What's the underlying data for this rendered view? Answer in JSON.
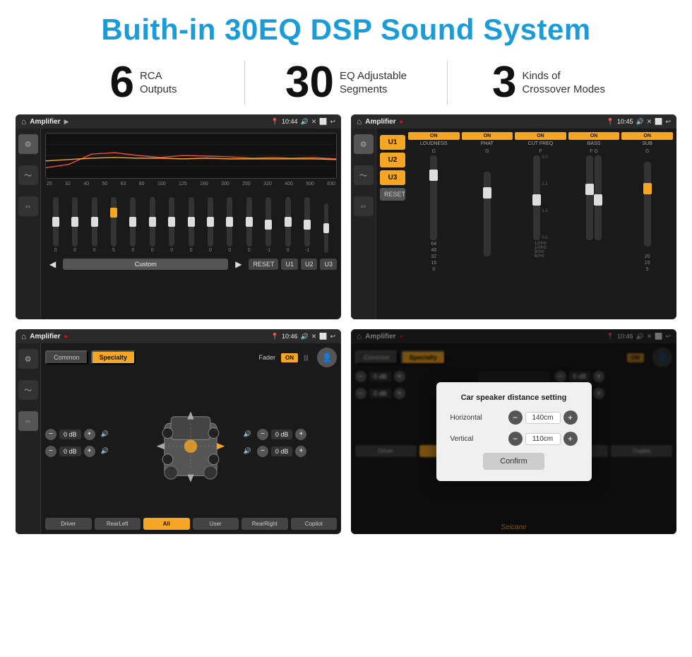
{
  "header": {
    "title": "Buith-in 30EQ DSP Sound System"
  },
  "stats": [
    {
      "number": "6",
      "label": "RCA\nOutputs"
    },
    {
      "number": "30",
      "label": "EQ Adjustable\nSegments"
    },
    {
      "number": "3",
      "label": "Kinds of\nCrossover Modes"
    }
  ],
  "screens": [
    {
      "id": "screen1",
      "title": "Amplifier",
      "time": "10:44",
      "type": "eq"
    },
    {
      "id": "screen2",
      "title": "Amplifier",
      "time": "10:45",
      "type": "amp"
    },
    {
      "id": "screen3",
      "title": "Amplifier",
      "time": "10:46",
      "type": "fader"
    },
    {
      "id": "screen4",
      "title": "Amplifier",
      "time": "10:46",
      "type": "dialog"
    }
  ],
  "eq": {
    "frequencies": [
      "25",
      "32",
      "40",
      "50",
      "63",
      "80",
      "100",
      "125",
      "160",
      "200",
      "250",
      "320",
      "400",
      "500",
      "630"
    ],
    "values": [
      "0",
      "0",
      "0",
      "5",
      "0",
      "0",
      "0",
      "0",
      "0",
      "0",
      "0",
      "-1",
      "0",
      "-1"
    ],
    "presets": [
      "U1",
      "U2",
      "U3"
    ],
    "reset": "RESET",
    "mode": "Custom"
  },
  "amp": {
    "channels": [
      "LOUDNESS",
      "PHAT",
      "CUT FREQ",
      "BASS",
      "SUB"
    ],
    "channel_labels": [
      "U1",
      "U2",
      "U3"
    ],
    "reset": "RESET"
  },
  "fader": {
    "tabs": [
      "Common",
      "Specialty"
    ],
    "label": "Fader",
    "toggle": "ON",
    "positions": [
      "Driver",
      "RearLeft",
      "All",
      "User",
      "RearRight",
      "Copilot"
    ],
    "db_rows": [
      {
        "val": "0 dB"
      },
      {
        "val": "0 dB"
      },
      {
        "val": "0 dB"
      },
      {
        "val": "0 dB"
      }
    ]
  },
  "dialog": {
    "title": "Car speaker distance setting",
    "horizontal_label": "Horizontal",
    "horizontal_value": "140cm",
    "vertical_label": "Vertical",
    "vertical_value": "110cm",
    "confirm": "Confirm"
  },
  "watermark": "Seicane"
}
